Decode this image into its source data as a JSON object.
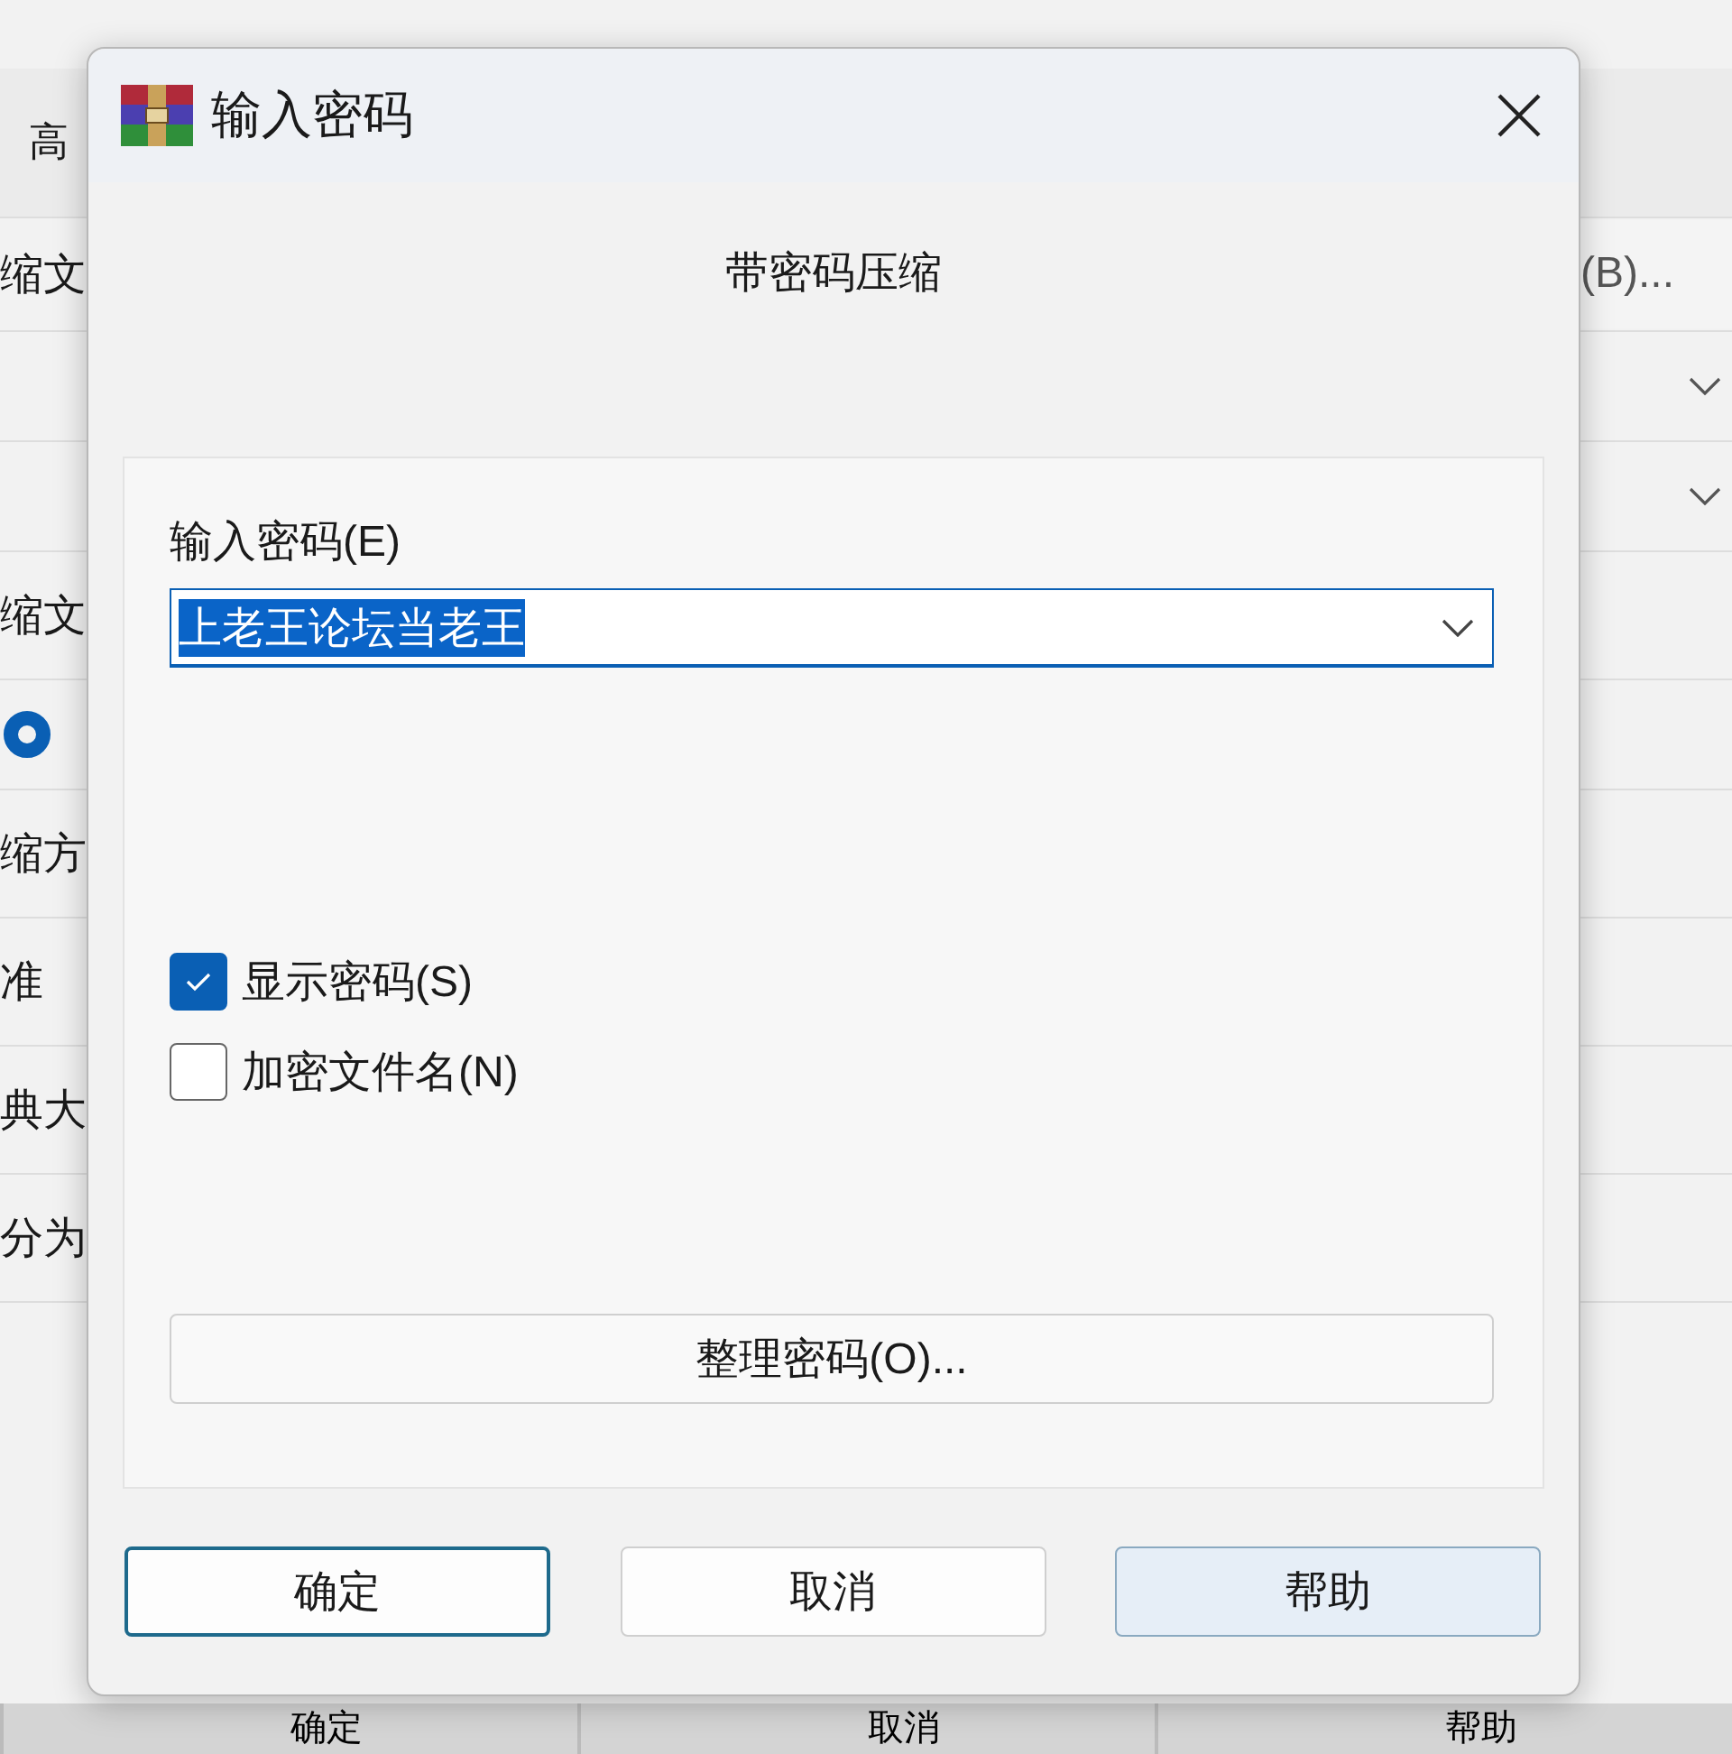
{
  "background_dialog": {
    "tab": "高",
    "browse_button": "(B)...",
    "rows": [
      {
        "kind": "label",
        "text": "缩文"
      },
      {
        "kind": "dropdown"
      },
      {
        "kind": "dropdown"
      },
      {
        "kind": "label",
        "text": "缩文"
      },
      {
        "kind": "radio",
        "selected": true
      },
      {
        "kind": "label",
        "text": "缩方"
      },
      {
        "kind": "label",
        "text": "准"
      },
      {
        "kind": "label",
        "text": "典大"
      },
      {
        "kind": "label",
        "text": "分为"
      }
    ],
    "buttons": [
      "确定",
      "取消",
      "帮助"
    ]
  },
  "dialog": {
    "title": "输入密码",
    "subtitle": "带密码压缩",
    "password_label": "输入密码(E)",
    "password_value": "上老王论坛当老王",
    "text_selected": true,
    "options": [
      {
        "label": "显示密码(S)",
        "checked": true
      },
      {
        "label": "加密文件名(N)",
        "checked": false
      }
    ],
    "organize_button": "整理密码(O)...",
    "buttons": [
      {
        "label": "确定",
        "focused": true,
        "hovered": false
      },
      {
        "label": "取消",
        "focused": false,
        "hovered": false
      },
      {
        "label": "帮助",
        "focused": false,
        "hovered": true
      }
    ]
  }
}
